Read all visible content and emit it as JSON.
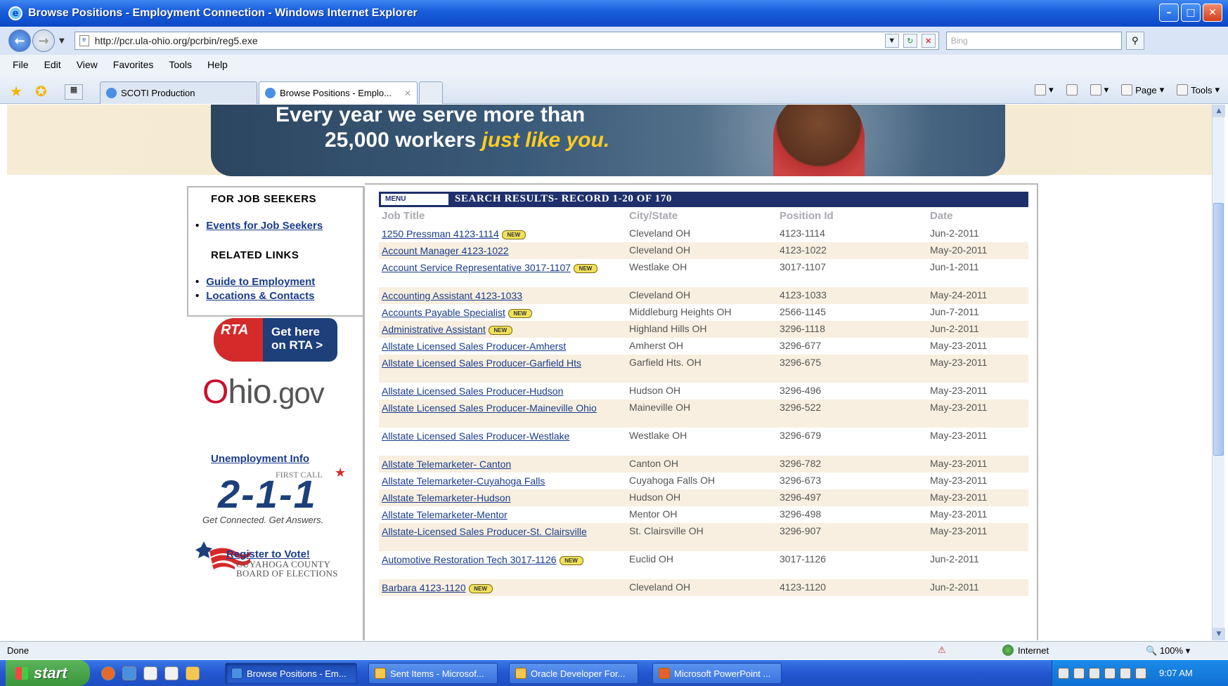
{
  "window": {
    "title": "Browse Positions - Employment Connection - Windows Internet Explorer",
    "controls": [
      "minimize",
      "maximize",
      "close"
    ]
  },
  "address_bar": {
    "url": "http://pcr.ula-ohio.org/pcrbin/reg5.exe",
    "search_placeholder": "Bing"
  },
  "menu": [
    "File",
    "Edit",
    "View",
    "Favorites",
    "Tools",
    "Help"
  ],
  "tabs": [
    {
      "label": "SCOTI Production"
    },
    {
      "label": "Browse Positions - Emplo..."
    }
  ],
  "command_bar": {
    "page": "Page",
    "tools": "Tools"
  },
  "banner": {
    "line1": "Every year we serve more than",
    "line2_prefix": "25,000 workers",
    "line2_accent": "just like you."
  },
  "left_nav": {
    "heading_seekers": "FOR JOB SEEKERS",
    "events_link": "Events for Job Seekers",
    "heading_related": "RELATED LINKS",
    "guide_link": "Guide to Employment",
    "locations_link": "Locations & Contacts"
  },
  "side_logos": {
    "rta_brand": "RTA",
    "rta_text_line1": "Get here",
    "rta_text_line2": "on RTA >",
    "ohio_logo_O": "O",
    "ohio_logo_hio": "hio",
    "ohio_logo_gov": ".gov",
    "ohio_link": "Unemployment Info",
    "logo211_firstcall": "FIRST CALL",
    "logo211_number": "2-1-1",
    "logo211_tagline": "Get Connected. Get Answers.",
    "cuyahoga_line1": "CUYAHOGA COUNTY",
    "cuyahoga_line2": "BOARD OF ELECTIONS",
    "vote_link": "Register to Vote!"
  },
  "results": {
    "menu_label": "MENU",
    "title": "SEARCH RESULTS- RECORD 1-20 OF 170",
    "columns": [
      "Job Title",
      "City/State",
      "Position Id",
      "Date"
    ],
    "new_badge": "NEW",
    "rows": [
      {
        "title": "1250 Pressman 4123-1114",
        "new": true,
        "city": "Cleveland OH",
        "pos": "4123-1114",
        "date": "Jun-2-2011"
      },
      {
        "title": "Account Manager 4123-1022",
        "new": false,
        "city": "Cleveland OH",
        "pos": "4123-1022",
        "date": "May-20-2011"
      },
      {
        "title": "Account Service Representative 3017-1107",
        "new": true,
        "city": "Westlake OH",
        "pos": "3017-1107",
        "date": "Jun-1-2011"
      },
      {
        "title": "Accounting Assistant 4123-1033",
        "new": false,
        "city": "Cleveland OH",
        "pos": "4123-1033",
        "date": "May-24-2011"
      },
      {
        "title": "Accounts Payable Specialist",
        "new": true,
        "city": "Middleburg Heights OH",
        "pos": "2566-1145",
        "date": "Jun-7-2011"
      },
      {
        "title": "Administrative Assistant",
        "new": true,
        "city": "Highland Hills OH",
        "pos": "3296-1118",
        "date": "Jun-2-2011"
      },
      {
        "title": "Allstate Licensed Sales Producer-Amherst",
        "new": false,
        "city": "Amherst OH",
        "pos": "3296-677",
        "date": "May-23-2011"
      },
      {
        "title": "Allstate Licensed Sales Producer-Garfield Hts",
        "new": false,
        "city": "Garfield Hts. OH",
        "pos": "3296-675",
        "date": "May-23-2011"
      },
      {
        "title": "Allstate Licensed Sales Producer-Hudson",
        "new": false,
        "city": "Hudson OH",
        "pos": "3296-496",
        "date": "May-23-2011"
      },
      {
        "title": "Allstate Licensed Sales Producer-Maineville Ohio",
        "new": false,
        "city": "Maineville OH",
        "pos": "3296-522",
        "date": "May-23-2011"
      },
      {
        "title": "Allstate Licensed Sales Producer-Westlake",
        "new": false,
        "city": "Westlake OH",
        "pos": "3296-679",
        "date": "May-23-2011"
      },
      {
        "title": "Allstate Telemarketer- Canton",
        "new": false,
        "city": "Canton OH",
        "pos": "3296-782",
        "date": "May-23-2011"
      },
      {
        "title": "Allstate Telemarketer-Cuyahoga Falls",
        "new": false,
        "city": "Cuyahoga Falls OH",
        "pos": "3296-673",
        "date": "May-23-2011"
      },
      {
        "title": "Allstate Telemarketer-Hudson",
        "new": false,
        "city": "Hudson OH",
        "pos": "3296-497",
        "date": "May-23-2011"
      },
      {
        "title": "Allstate Telemarketer-Mentor",
        "new": false,
        "city": "Mentor OH",
        "pos": "3296-498",
        "date": "May-23-2011"
      },
      {
        "title": "Allstate-Licensed Sales Producer-St. Clairsville",
        "new": false,
        "city": "St. Clairsville OH",
        "pos": "3296-907",
        "date": "May-23-2011"
      },
      {
        "title": "Automotive Restoration Tech 3017-1126",
        "new": true,
        "city": "Euclid OH",
        "pos": "3017-1126",
        "date": "Jun-2-2011"
      },
      {
        "title": "Barbara 4123-1120",
        "new": true,
        "city": "Cleveland OH",
        "pos": "4123-1120",
        "date": "Jun-2-2011"
      }
    ]
  },
  "status_bar": {
    "status": "Done",
    "zone": "Internet",
    "zoom": "100%"
  },
  "taskbar": {
    "start": "start",
    "buttons": [
      "Browse Positions - Em...",
      "Sent Items - Microsof...",
      "Oracle Developer For...",
      "Microsoft PowerPoint ..."
    ],
    "clock": "9:07 AM"
  },
  "colors": {
    "header_navy": "#1e2f6b",
    "link_blue": "#1a3c8c",
    "row_alt": "#f8efe0",
    "banner_accent": "#ffcc22"
  }
}
